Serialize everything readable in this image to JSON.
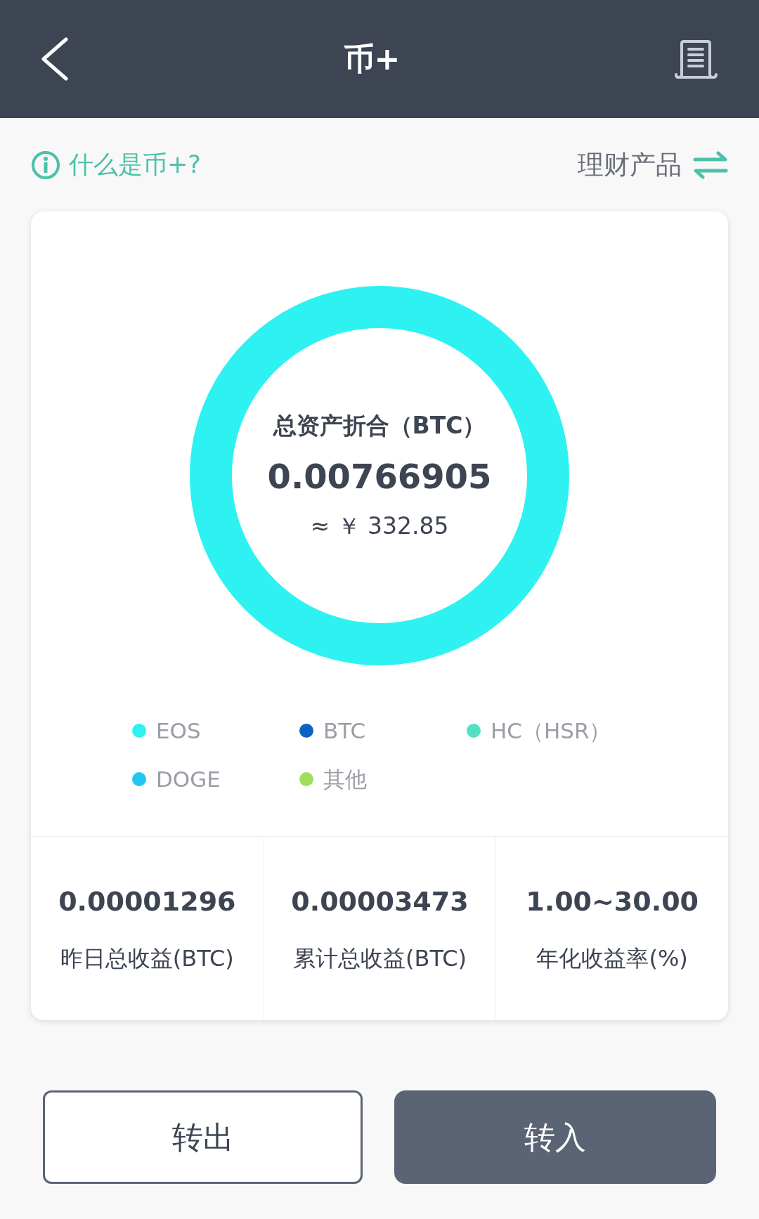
{
  "header": {
    "title": "币+"
  },
  "info_link": "什么是币+?",
  "products_link": "理财产品",
  "summary": {
    "title": "总资产折合（BTC）",
    "amount": "0.00766905",
    "fiat": "≈ ￥ 332.85"
  },
  "legend": [
    {
      "label": "EOS",
      "color": "#2ef2f2"
    },
    {
      "label": "BTC",
      "color": "#0b62c4"
    },
    {
      "label": "HC（HSR）",
      "color": "#55e0c4"
    },
    {
      "label": "DOGE",
      "color": "#1ec8f0"
    },
    {
      "label": "其他",
      "color": "#9fde5f"
    }
  ],
  "stats": [
    {
      "value": "0.00001296",
      "label": "昨日总收益(BTC)"
    },
    {
      "value": "0.00003473",
      "label": "累计总收益(BTC)"
    },
    {
      "value": "1.00~30.00",
      "label": "年化收益率(%)"
    }
  ],
  "buttons": [
    {
      "label": "转出",
      "kind": "outline"
    },
    {
      "label": "转入",
      "kind": "filled"
    }
  ]
}
